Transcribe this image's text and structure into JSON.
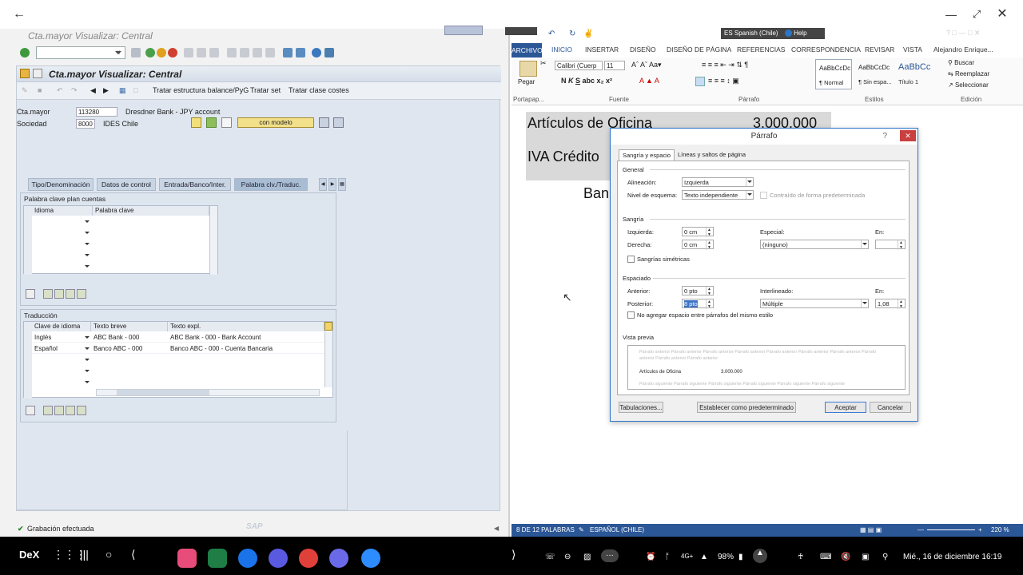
{
  "sap": {
    "window_title": "Cta.mayor Visualizar: Central",
    "screen_title": "Cta.mayor Visualizar: Central",
    "appbar": [
      "Tratar estructura balance/PyG",
      "Tratar set",
      "Tratar clase costes"
    ],
    "fields": {
      "cta_label": "Cta.mayor",
      "cta_value": "113280",
      "cta_desc": "Dresdner Bank - JPY account",
      "soc_label": "Sociedad",
      "soc_value": "8000",
      "soc_desc": "IDES Chile",
      "model_button": "con modelo"
    },
    "tabs": [
      "Tipo/Denominación",
      "Datos de control",
      "Entrada/Banco/Inter.",
      "Palabra clv./Traduc."
    ],
    "keywords": {
      "title": "Palabra clave plan cuentas",
      "headers": [
        "Idioma",
        "Palabra clave"
      ]
    },
    "translation": {
      "title": "Traducción",
      "headers": [
        "Clave de idioma",
        "Texto breve",
        "Texto expl."
      ],
      "rows": [
        {
          "lang": "Inglés",
          "short": "ABC Bank - 000",
          "long": "ABC Bank - 000 - Bank Account"
        },
        {
          "lang": "Español",
          "short": "Banco ABC - 000",
          "long": "Banco ABC - 000 - Cuenta Bancaria"
        }
      ]
    },
    "status": "Grabación efectuada",
    "brand": "SAP"
  },
  "word": {
    "language_badge": "ES Spanish (Chile)",
    "help": "Help",
    "tabs": [
      "ARCHIVO",
      "INICIO",
      "INSERTAR",
      "DISEÑO",
      "DISEÑO DE PÁGINA",
      "REFERENCIAS",
      "CORRESPONDENCIA",
      "REVISAR",
      "VISTA",
      "Alejandro Enrique..."
    ],
    "font_name": "Calibri (Cuerp",
    "font_size": "11",
    "paste": "Pegar",
    "styles": [
      {
        "sample": "AaBbCcDc",
        "name": "¶ Normal"
      },
      {
        "sample": "AaBbCcDc",
        "name": "¶ Sin espa..."
      },
      {
        "sample": "AaBbCc",
        "name": "Título 1"
      }
    ],
    "edit": [
      "Buscar",
      "Reemplazar",
      "Seleccionar"
    ],
    "groups": [
      "Portapap...",
      "Fuente",
      "Párrafo",
      "Estilos",
      "Edición"
    ],
    "doc_lines": [
      {
        "text": "Artículos de Oficina",
        "amount": "3.000.000"
      },
      {
        "text": "IVA Crédito",
        "amount": ""
      },
      {
        "text": "Ban",
        "amount": ""
      }
    ],
    "status_left": "8 DE 12 PALABRAS",
    "status_lang": "ESPAÑOL (CHILE)",
    "zoom": "220 %"
  },
  "dialog": {
    "title": "Párrafo",
    "tabs": [
      "Sangría y espacio",
      "Líneas y saltos de página"
    ],
    "general": "General",
    "alineacion_label": "Alineación:",
    "alineacion_value": "Izquierda",
    "esquema_label": "Nivel de esquema:",
    "esquema_value": "Texto independiente",
    "contraido": "Contraído de forma predeterminada",
    "sangria": "Sangría",
    "izquierda_label": "Izquierda:",
    "izquierda_value": "0 cm",
    "derecha_label": "Derecha:",
    "derecha_value": "0 cm",
    "especial_label": "Especial:",
    "especial_value": "(ninguno)",
    "en_label": "En:",
    "simetricas": "Sangrías simétricas",
    "espaciado": "Espaciado",
    "anterior_label": "Anterior:",
    "anterior_value": "0 pto",
    "posterior_label": "Posterior:",
    "posterior_value": "8 pto",
    "interlineado_label": "Interlineado:",
    "interlineado_value": "Múltiple",
    "en2_label": "En:",
    "en2_value": "1,08",
    "no_agregar": "No agregar espacio entre párrafos del mismo estilo",
    "vista": "Vista previa",
    "preview_prev": "Párrafo anterior Párrafo anterior Párrafo anterior Párrafo anterior Párrafo anterior Párrafo anterior Párrafo anterior Párrafo anterior Párrafo anterior Párrafo anterior",
    "preview_text": "Artículos de Oficina",
    "preview_amount": "3.000.000",
    "preview_next": "Párrafo siguiente Párrafo siguiente Párrafo siguiente Párrafo siguiente Párrafo siguiente Párrafo siguiente",
    "btn_tab": "Tabulaciones...",
    "btn_default": "Establecer como predeterminado",
    "btn_ok": "Aceptar",
    "btn_cancel": "Cancelar"
  },
  "taskbar": {
    "dex": "DeX",
    "battery": "98%",
    "datetime": "Mié., 16 de diciembre 16:19",
    "signal": "4G+"
  }
}
